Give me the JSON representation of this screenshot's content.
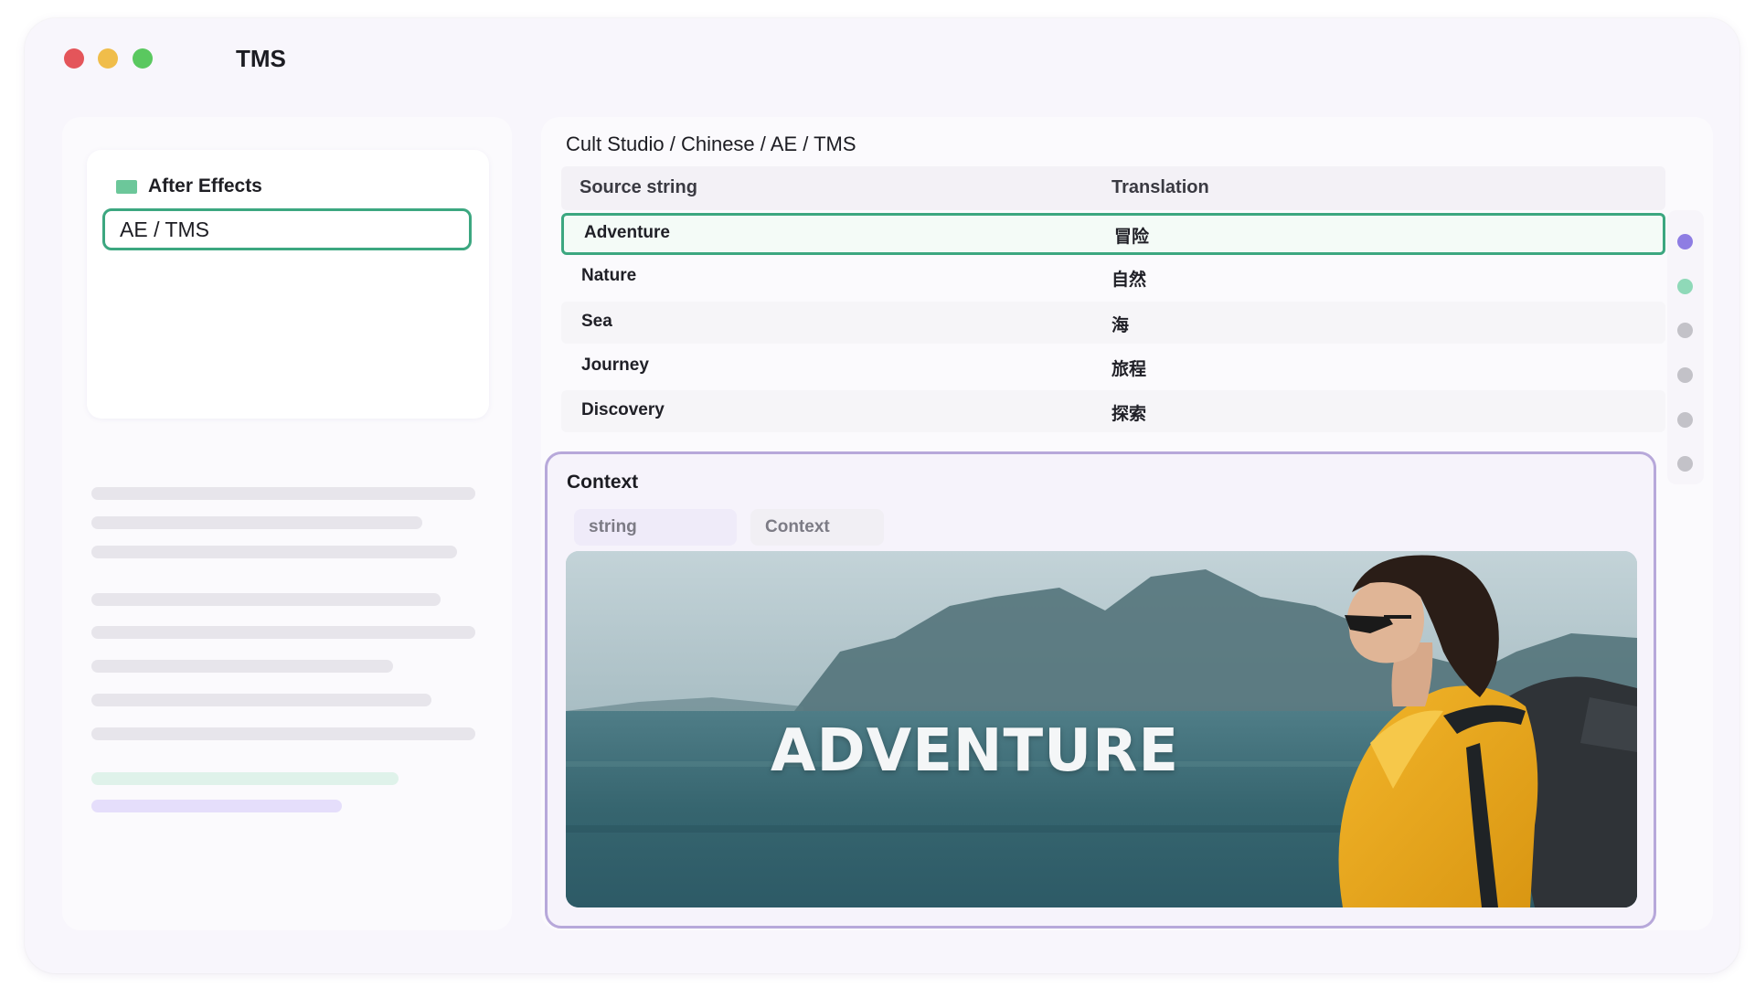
{
  "window": {
    "title": "TMS",
    "controls": [
      "close",
      "minimize",
      "maximize"
    ]
  },
  "sidebar": {
    "folder_label": "After Effects",
    "folder_icon": "folder-icon",
    "selected_item": "AE / TMS"
  },
  "main": {
    "breadcrumb": "Cult Studio / Chinese / AE / TMS",
    "table": {
      "headers": {
        "source": "Source string",
        "translation": "Translation"
      },
      "rows": [
        {
          "source": "Adventure",
          "translation": "冒险"
        },
        {
          "source": "Nature",
          "translation": "自然"
        },
        {
          "source": "Sea",
          "translation": "海"
        },
        {
          "source": "Journey",
          "translation": "旅程"
        },
        {
          "source": "Discovery",
          "translation": "探索"
        }
      ],
      "selected_row": 0
    },
    "context": {
      "title": "Context",
      "tabs": [
        "string",
        "Context"
      ],
      "preview_text": "ADVENTURE"
    }
  },
  "colors": {
    "accent_green": "#3ca780",
    "accent_purple": "#b7a8da",
    "status_purple": "#8e7de3",
    "status_green": "#8fd9b8",
    "status_gray": "#c3c2c8"
  }
}
